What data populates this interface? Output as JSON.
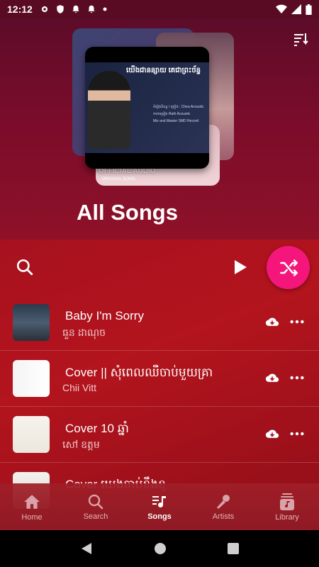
{
  "status_bar": {
    "time": "12:12"
  },
  "header": {
    "title": "All Songs"
  },
  "cover": {
    "khmer_title": "យើងជានន្សាយ គេជាព្រះច័ន្ទ",
    "credit_lines": [
      "ចំរៀងនិពន្ធ / ច្រៀង : Chea Acoustic",
      "ការចម្រៀង Rath Acoustic",
      "Mix and Master SMD Record"
    ],
    "back_label": "OFFICIAL AUDIO",
    "back_sub": "ORIGINAL SONG"
  },
  "songs": [
    {
      "title": "Baby I'm Sorry",
      "artist": "ធួន ដាណុច",
      "thumb": "thumb1"
    },
    {
      "title": "Cover || សុំពេលឈឺចាប់មួយគ្រា",
      "artist": "Chii Vitt",
      "thumb": "thumb2"
    },
    {
      "title": "Cover 10  ឆ្នាំ",
      "artist": "សៅ ឧត្តម",
      "thumb": "thumb3"
    },
    {
      "title": "Cover ឃេងចាប់ខឹងខុ",
      "artist": "",
      "thumb": "thumb4"
    }
  ],
  "nav": [
    {
      "label": "Home",
      "icon": "home-icon",
      "active": false
    },
    {
      "label": "Search",
      "icon": "search-icon",
      "active": false
    },
    {
      "label": "Songs",
      "icon": "music-note-icon",
      "active": true
    },
    {
      "label": "Artists",
      "icon": "microphone-icon",
      "active": false
    },
    {
      "label": "Library",
      "icon": "library-icon",
      "active": false
    }
  ],
  "colors": {
    "accent": "#f5167c",
    "hero_bg": "#6a0c2a",
    "list_bg": "#a7111f"
  }
}
